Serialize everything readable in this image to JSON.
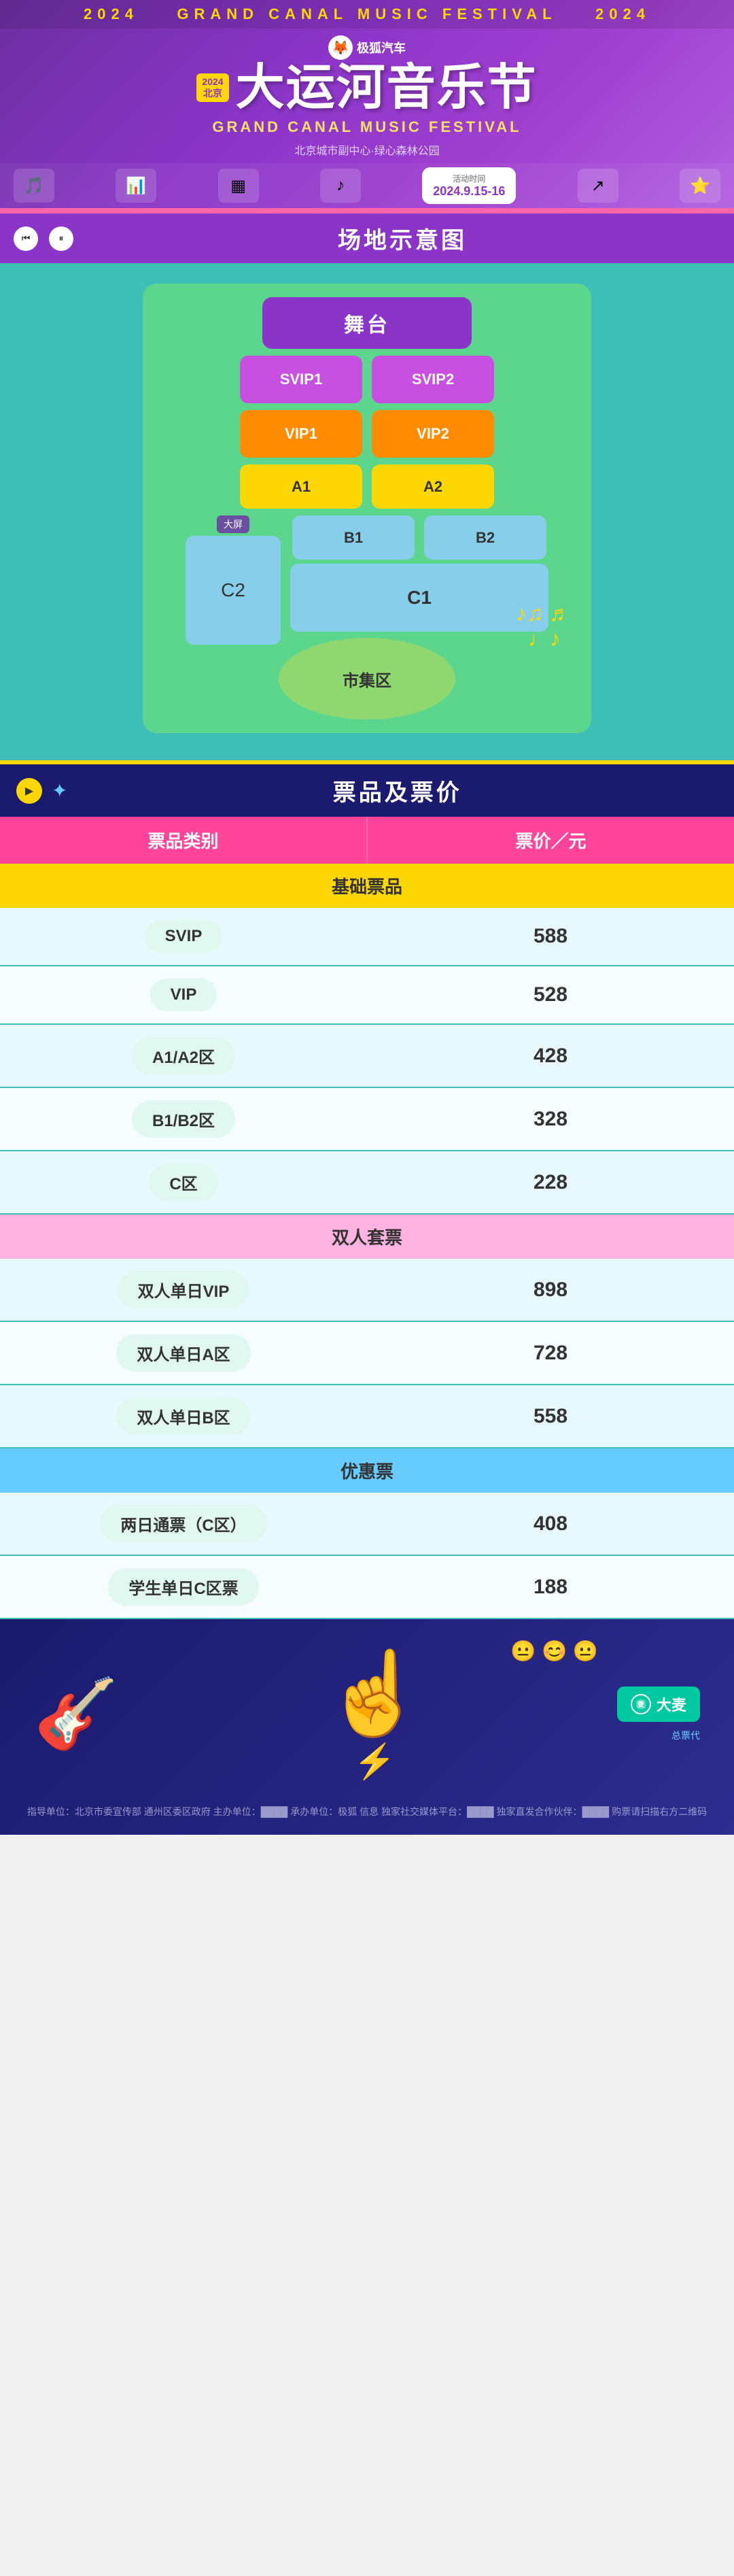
{
  "header": {
    "year": "2024",
    "event_name": "GRAND CANAL MUSIC FESTIVAL",
    "brand": "极狐汽车",
    "main_title": "大运河音乐节",
    "subtitle": "GRAND CANAL MUSIC FESTIVAL",
    "location": "北京城市副中心·绿心森林公园",
    "date_label": "活动时间",
    "date_value": "2024.9.15-16",
    "city": "北京"
  },
  "venue": {
    "title": "场地示意图",
    "stage": "舞台",
    "screen_label": "大屏",
    "zones": {
      "svip1": "SVIP1",
      "svip2": "SVIP2",
      "vip1": "VIP1",
      "vip2": "VIP2",
      "a1": "A1",
      "a2": "A2",
      "b1": "B1",
      "b2": "B2",
      "c1": "C1",
      "c2": "C2",
      "market": "市集区"
    },
    "controls": {
      "prev": "⏮",
      "pause": "⏸"
    }
  },
  "tickets": {
    "section_title": "票品及票价",
    "col_type": "票品类别",
    "col_price": "票价／元",
    "basic_header": "基础票品",
    "couple_header": "双人套票",
    "discount_header": "优惠票",
    "rows": [
      {
        "name": "SVIP",
        "price": "588"
      },
      {
        "name": "VIP",
        "price": "528"
      },
      {
        "name": "A1/A2区",
        "price": "428"
      },
      {
        "name": "B1/B2区",
        "price": "328"
      },
      {
        "name": "C区",
        "price": "228"
      }
    ],
    "couple_rows": [
      {
        "name": "双人单日VIP",
        "price": "898"
      },
      {
        "name": "双人单日A区",
        "price": "728"
      },
      {
        "name": "双人单日B区",
        "price": "558"
      }
    ],
    "discount_rows": [
      {
        "name": "两日通票（C区）",
        "price": "408"
      },
      {
        "name": "学生单日C区票",
        "price": "188"
      }
    ]
  },
  "footer": {
    "agent_label": "总票代",
    "damai": "大麦",
    "info": "指导单位：北京市委宣传部 通州区委区政府    主办单位：████    承办单位：极狐 信息    独家社交媒体平台：████    独家直发合作伙伴：████ 购票请扫描右方二维码",
    "decorations": {
      "guitar": "🎸",
      "hand": "☝",
      "lightning": "⚡"
    }
  },
  "side_text": "GRAND CANAL MUSIC FESTIVAL"
}
